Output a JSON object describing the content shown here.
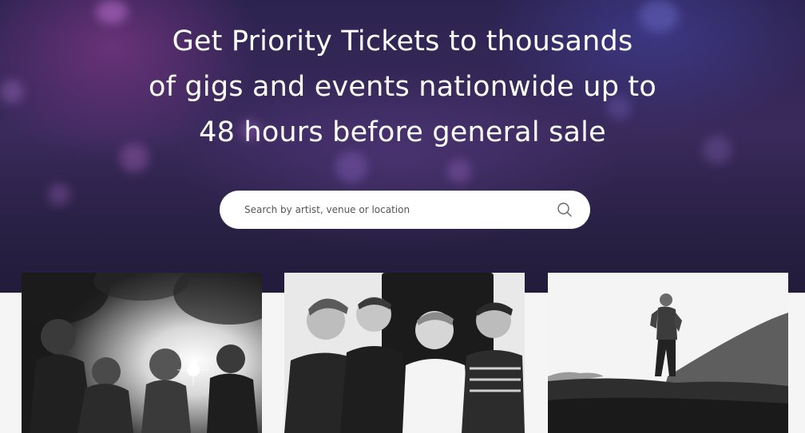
{
  "hero": {
    "headline_lines": [
      "Get Priority Tickets to thousands",
      "of gigs and events nationwide up to",
      "48 hours before general sale"
    ]
  },
  "search": {
    "placeholder": "Search by artist, venue or location",
    "icon": "search-icon"
  },
  "cards": [
    {
      "image": "band-photo-backlit-trees",
      "interactable": true
    },
    {
      "image": "band-photo-four-members-group",
      "interactable": true
    },
    {
      "image": "artist-photo-standing-on-hill",
      "interactable": true
    }
  ],
  "colors": {
    "hero_dark": "#2c2350",
    "hero_purple": "#3a2a5c",
    "text_white": "#ffffff",
    "page_bg": "#f5f5f5"
  }
}
